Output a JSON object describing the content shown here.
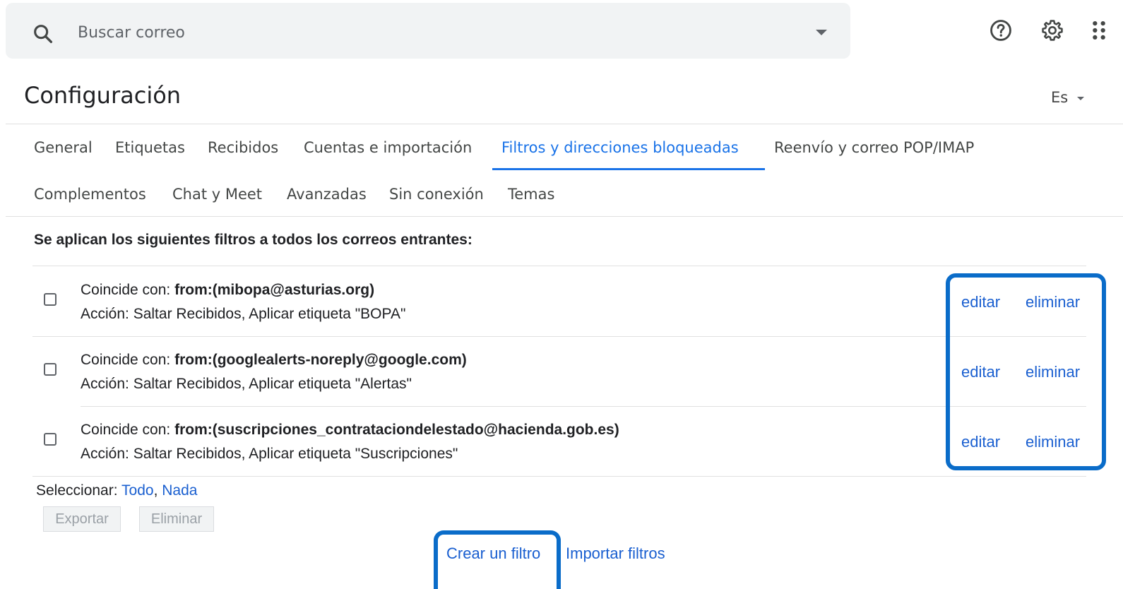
{
  "search": {
    "placeholder": "Buscar correo"
  },
  "icons": {
    "search": "search-icon",
    "options": "chevron-down-icon",
    "help": "help-icon",
    "settings": "gear-icon",
    "apps": "apps-grid-icon"
  },
  "header": {
    "title": "Configuración",
    "language": "Es"
  },
  "tabs": [
    {
      "label": "General"
    },
    {
      "label": "Etiquetas"
    },
    {
      "label": "Recibidos"
    },
    {
      "label": "Cuentas e importación"
    },
    {
      "label": "Filtros y direcciones bloqueadas",
      "active": true
    },
    {
      "label": "Reenvío y correo POP/IMAP"
    },
    {
      "label": "Complementos"
    },
    {
      "label": "Chat y Meet"
    },
    {
      "label": "Avanzadas"
    },
    {
      "label": "Sin conexión"
    },
    {
      "label": "Temas"
    }
  ],
  "filters": {
    "heading": "Se aplican los siguientes filtros a todos los correos entrantes:",
    "match_prefix": "Coincide con: ",
    "edit_label": "editar",
    "delete_label": "eliminar",
    "rows": [
      {
        "criteria": "from:(mibopa@asturias.org)",
        "action": "Acción: Saltar Recibidos, Aplicar etiqueta \"BOPA\""
      },
      {
        "criteria": "from:(googlealerts-noreply@google.com)",
        "action": "Acción: Saltar Recibidos, Aplicar etiqueta \"Alertas\""
      },
      {
        "criteria": "from:(suscripciones_contrataciondelestado@hacienda.gob.es)",
        "action": "Acción: Saltar Recibidos, Aplicar etiqueta \"Suscripciones\""
      }
    ],
    "select_prefix": "Seleccionar: ",
    "select_all": "Todo",
    "select_separator": ", ",
    "select_none": "Nada",
    "export_label": "Exportar",
    "delete_selected_label": "Eliminar",
    "create_label": "Crear un filtro",
    "import_label": "Importar filtros"
  },
  "colors": {
    "accent": "#1a73e8",
    "link": "#1a5fd0",
    "highlight": "#0a6cc9",
    "search_bg": "#f1f3f4"
  }
}
